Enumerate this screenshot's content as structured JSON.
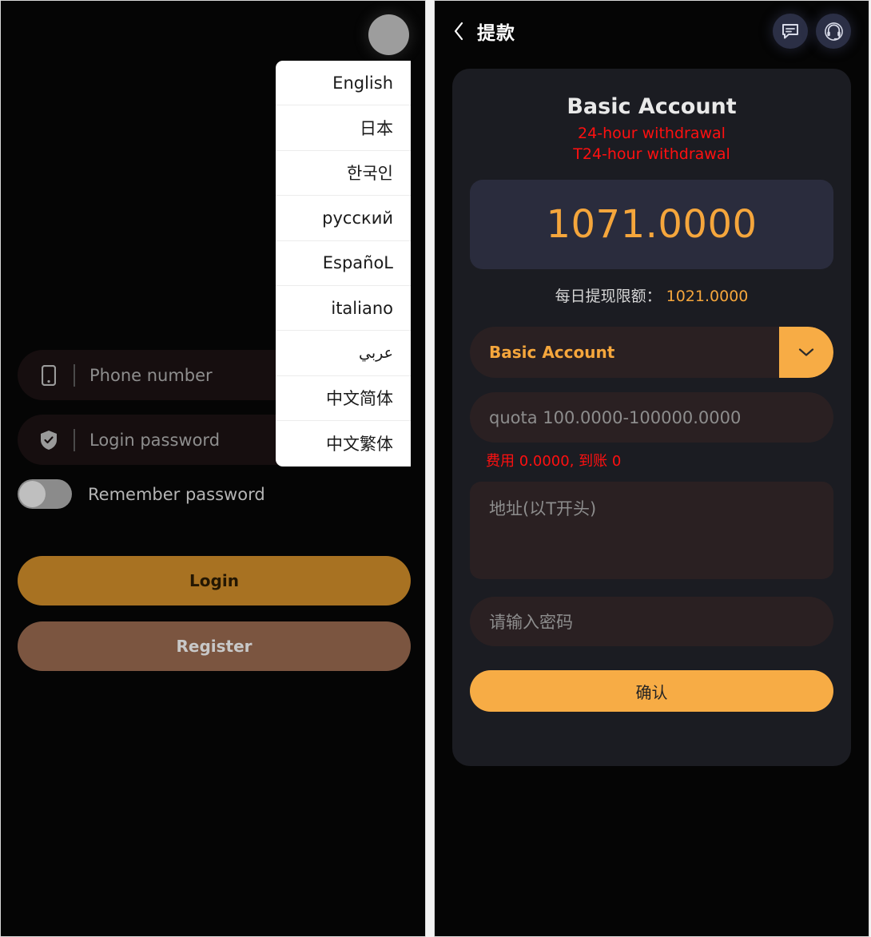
{
  "login_panel": {
    "avatar_icon": "avatar-circle-icon",
    "language_menu": {
      "items": [
        {
          "label": "English"
        },
        {
          "label": "日本"
        },
        {
          "label": "한국인"
        },
        {
          "label": "русский"
        },
        {
          "label": "EspañoL"
        },
        {
          "label": "italiano"
        },
        {
          "label": "عربي"
        },
        {
          "label": "中文简体"
        },
        {
          "label": "中文繁体"
        }
      ]
    },
    "phone_field": {
      "placeholder": "Phone number",
      "icon": "mobile-phone-icon"
    },
    "password_field": {
      "placeholder": "Login password",
      "icon": "shield-check-icon"
    },
    "remember": {
      "label": "Remember password",
      "state": "off"
    },
    "login_button": "Login",
    "register_button": "Register"
  },
  "withdraw_panel": {
    "topbar": {
      "back_icon": "back-chevron-icon",
      "title": "提款",
      "message_icon": "chat-bubble-icon",
      "support_icon": "headset-support-icon"
    },
    "account_title": "Basic Account",
    "notes": [
      "24-hour withdrawal",
      "T24-hour withdrawal"
    ],
    "balance": "1071.0000",
    "daily_limit_label": "每日提现限额：",
    "daily_limit_value": "1021.0000",
    "account_select": {
      "value": "Basic Account",
      "arrow_icon": "chevron-down-icon"
    },
    "amount_input": {
      "placeholder": "quota 100.0000-100000.0000"
    },
    "fee_note": "费用 0.0000, 到账 0",
    "address_input": {
      "placeholder": "地址(以T开头)"
    },
    "password_input": {
      "placeholder": "请输入密码"
    },
    "confirm_button": "确认"
  },
  "colors": {
    "accent_orange": "#f7ac45",
    "balance_orange": "#f5a63c",
    "alert_red": "#ff1010",
    "login_gold": "#a87222",
    "register_brown": "#7b5540",
    "card_bg": "#1b1c22",
    "balance_bg": "#2a2c3d"
  }
}
